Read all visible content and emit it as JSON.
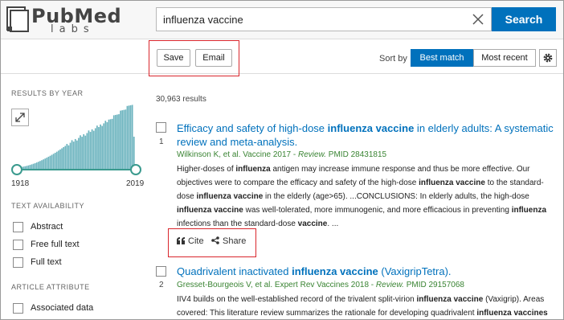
{
  "header": {
    "logo_main": "PubMed",
    "logo_sub": "labs",
    "search_value": "influenza vaccine",
    "search_button": "Search"
  },
  "actions": {
    "save": "Save",
    "email": "Email",
    "sort_by": "Sort by",
    "best_match": "Best match",
    "most_recent": "Most recent"
  },
  "sidebar": {
    "results_by_year": "RESULTS BY YEAR",
    "year_start": "1918",
    "year_end": "2019",
    "text_availability": "TEXT AVAILABILITY",
    "filters": [
      "Abstract",
      "Free full text",
      "Full text"
    ],
    "article_attribute": "ARTICLE ATTRIBUTE",
    "attributes": [
      "Associated data"
    ]
  },
  "results": {
    "count": "30,963 results",
    "items": [
      {
        "number": "1",
        "title_parts": [
          "Efficacy and safety of high-dose ",
          "influenza vaccine",
          " in elderly adults: A systematic review and meta-analysis."
        ],
        "authors": "Wilkinson K, et al. Vaccine 2017 - ",
        "type": "Review.",
        "pmid": " PMID 28431815",
        "snippet_parts": [
          "Higher-doses of ",
          "influenza",
          " antigen may increase immune response and thus be more effective. Our objectives were to compare the efficacy and safety of the high-dose ",
          "influenza vaccine",
          " to the standard-dose ",
          "influenza vaccine",
          " in the elderly (age>65). ...CONCLUSIONS: In elderly adults, the high-dose ",
          "influenza vaccine",
          " was well-tolerated, more immunogenic, and more efficacious in preventing ",
          "influenza",
          " infections than the standard-dose ",
          "vaccine",
          ". ..."
        ],
        "cite": "Cite",
        "share": "Share"
      },
      {
        "number": "2",
        "title_parts": [
          "Quadrivalent inactivated ",
          "influenza vaccine",
          " (VaxigripTetra)."
        ],
        "authors": "Gresset-Bourgeois V, et al. Expert Rev Vaccines 2018 - ",
        "type": "Review.",
        "pmid": " PMID 29157068",
        "snippet_parts": [
          "IIV4 builds on the well-established record of the trivalent split-virion ",
          "influenza vaccine",
          " (Vaxigrip). Areas covered: This literature review summarizes the rationale for developing quadrivalent ",
          "influenza vaccines",
          ""
        ]
      }
    ]
  },
  "colors": {
    "accent": "#0071bc",
    "histogram": "#6bb3be",
    "highlight_box": "#d9262c",
    "citation_green": "#3a8433"
  },
  "icons": [
    "clear-x-icon",
    "gear-icon",
    "expand-icon",
    "quote-icon",
    "share-icon",
    "book-logo-icon"
  ]
}
